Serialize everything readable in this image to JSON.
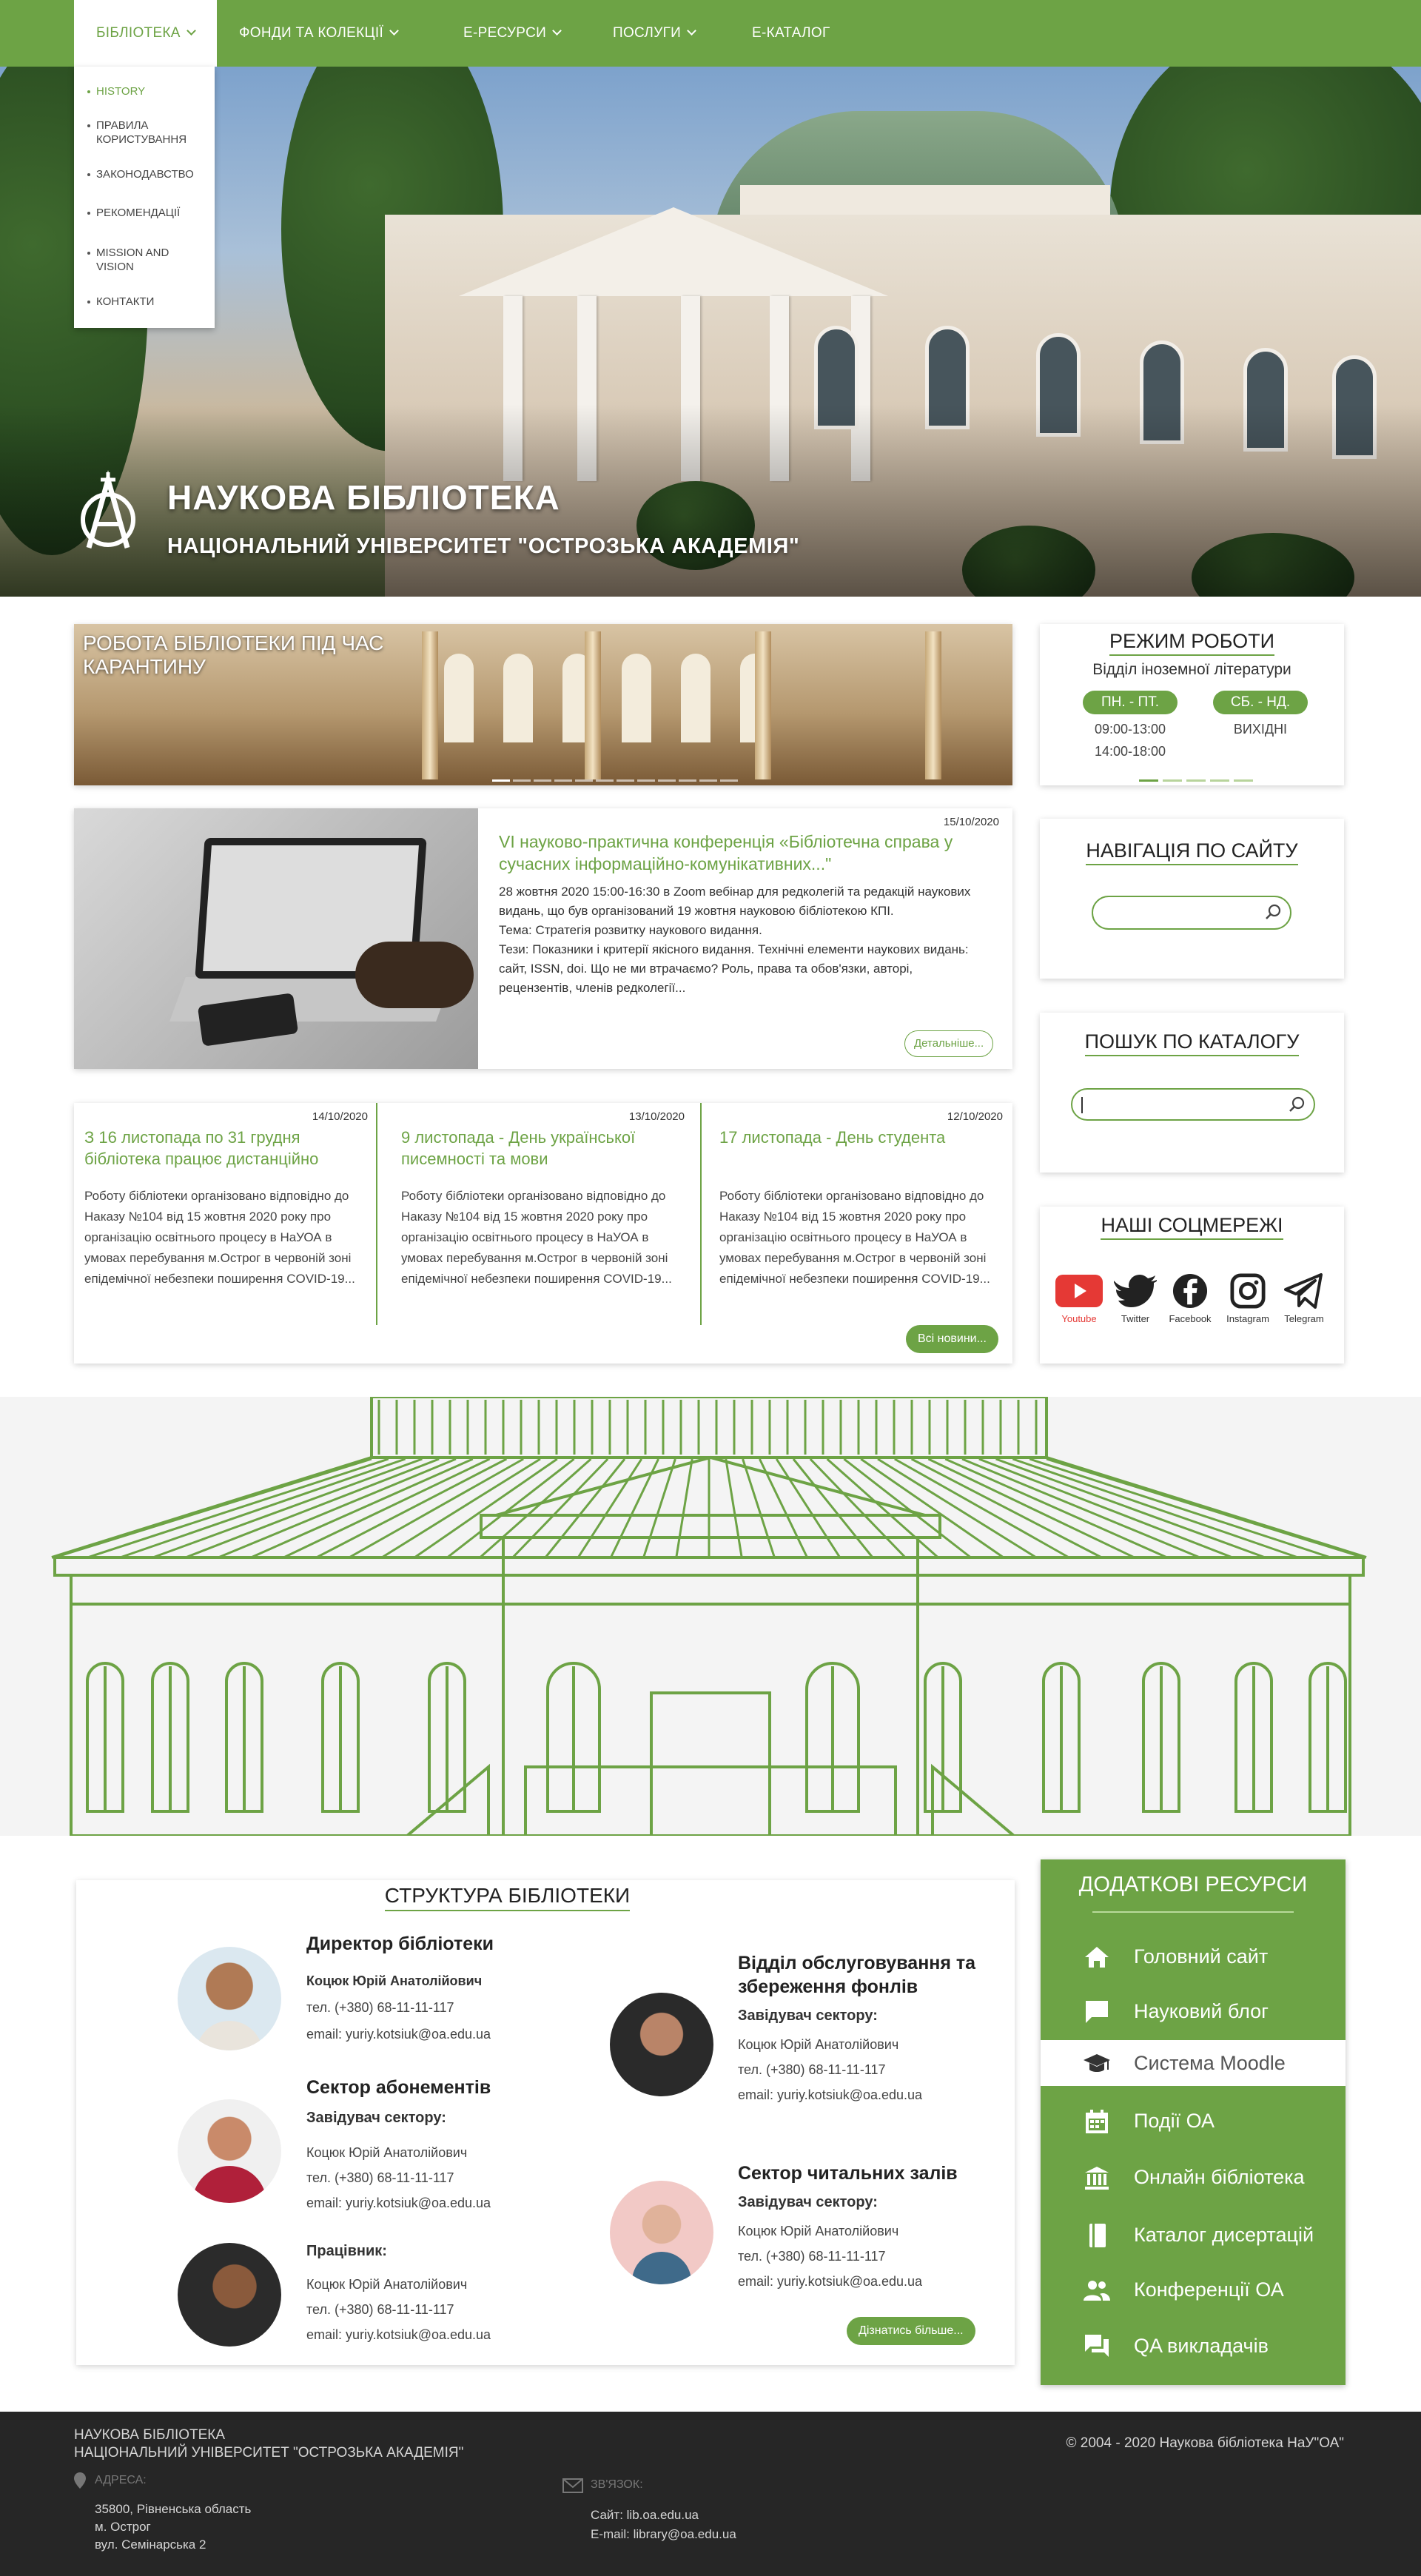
{
  "nav": {
    "items": [
      {
        "label": "БІБЛІОТЕКА"
      },
      {
        "label": "ФОНДИ ТА КОЛЕКЦІЇ"
      },
      {
        "label": "Е-РЕСУРСИ"
      },
      {
        "label": "ПОСЛУГИ"
      },
      {
        "label": "Е-КАТАЛОГ"
      }
    ],
    "dropdown": [
      "HISTORY",
      "ПРАВИЛА КОРИСТУВАННЯ",
      "ЗАКОНОДАВСТВО",
      "РЕКОМЕНДАЦІЇ",
      "MISSION AND VISION",
      "КОНТАКТИ"
    ]
  },
  "hero": {
    "title": "НАУКОВА БІБЛІОТЕКА",
    "subtitle": "НАЦІОНАЛЬНИЙ УНІВЕРСИТЕТ \"ОСТРОЗЬКА АКАДЕМІЯ\""
  },
  "slider": {
    "title": "РОБОТА БІБЛІОТЕКИ ПІД ЧАС КАРАНТИНУ",
    "dot_count": 12
  },
  "news_main": {
    "date": "15/10/2020",
    "title": "VI науково-практична конференція «Бібліотечна справа у сучасних інформаційно-комунікативних...\"",
    "text": "28 жовтня 2020 15:00-16:30 в Zoom вебінар для редколегій та редакцій наукових видань, що був організований 19 жовтня науковою бібліотекою КПІ.\nТема: Стратегія розвитку наукового видання.\nТези: Показники і критерії якісного видання. Технічні елементи наукових видань: сайт, ISSN, doi. Що не ми втрачаємо? Роль, права та обов'язки, авторі, рецензентів, членів редколегії...",
    "more": "Детальніше..."
  },
  "news": [
    {
      "date": "14/10/2020",
      "title": "З 16 листопада по 31 грудня бібліотека працює дистанційно",
      "text": "Роботу бібліотеки організовано відповідно до Наказу №104 від 15 жовтня 2020 року про організацію освітнього процесу в НаУОА в умовах перебування м.Острог в червоній зоні епідемічної небезпеки поширення COVID-19..."
    },
    {
      "date": "13/10/2020",
      "title": "9 листопада - День української писемності та мови",
      "text": "Роботу бібліотеки організовано відповідно до Наказу №104 від 15 жовтня 2020 року про організацію освітнього процесу в НаУОА в умовах перебування м.Острог в червоній зоні епідемічної небезпеки поширення COVID-19..."
    },
    {
      "date": "12/10/2020",
      "title": "17 листопада - День студента",
      "text": "Роботу бібліотеки організовано відповідно до Наказу №104 від 15 жовтня 2020 року про організацію освітнього процесу в НаУОА в умовах перебування м.Острог в червоній зоні епідемічної небезпеки поширення COVID-19..."
    }
  ],
  "all_news": "Всі новини...",
  "schedule": {
    "title": "РЕЖИМ РОБОТИ",
    "dept": "Відділ іноземної літератури",
    "weekdays": "ПН. - ПТ.",
    "weekend": "СБ. - НД.",
    "hours1": "09:00-13:00",
    "hours2": "14:00-18:00",
    "weekend_hours": "ВИХІДНІ"
  },
  "site_nav": {
    "title": "НАВІГАЦІЯ ПО САЙТУ",
    "placeholder": ""
  },
  "catalog": {
    "title": "ПОШУК ПО КАТАЛОГУ",
    "placeholder": ""
  },
  "social": {
    "title": "НАШІ СОЦМЕРЕЖІ",
    "items": [
      {
        "label": "Youtube",
        "icon": "youtube-icon"
      },
      {
        "label": "Twitter",
        "icon": "twitter-icon"
      },
      {
        "label": "Facebook",
        "icon": "facebook-icon"
      },
      {
        "label": "Instagram",
        "icon": "instagram-icon"
      },
      {
        "label": "Telegram",
        "icon": "telegram-icon"
      }
    ]
  },
  "structure": {
    "title": "СТРУКТУРА БІБЛІОТЕКИ",
    "people": [
      {
        "heading": "Директор бібліотеки",
        "role": "",
        "name": "Коцюк Юрій Анатолійович",
        "phone": "тел. (+380) 68-11-11-117",
        "email": "email: yuriy.kotsiuk@oa.edu.ua"
      },
      {
        "heading": "Сектор абонементів",
        "role": "Завідувач сектору:",
        "name": "Коцюк Юрій Анатолійович",
        "phone": "тел. (+380) 68-11-11-117",
        "email": "email: yuriy.kotsiuk@oa.edu.ua"
      },
      {
        "heading": "",
        "role": "Працівник:",
        "name": "Коцюк Юрій Анатолійович",
        "phone": "тел. (+380) 68-11-11-117",
        "email": "email: yuriy.kotsiuk@oa.edu.ua"
      },
      {
        "heading": "Відділ обслуговування та збереження фонлів",
        "role": "Завідувач сектору:",
        "name": "Коцюк Юрій Анатолійович",
        "phone": "тел. (+380) 68-11-11-117",
        "email": "email: yuriy.kotsiuk@oa.edu.ua"
      },
      {
        "heading": "Сектор читальних залів",
        "role": "Завідувач сектору:",
        "name": "Коцюк Юрій Анатолійович",
        "phone": "тел. (+380) 68-11-11-117",
        "email": "email: yuriy.kotsiuk@oa.edu.ua"
      }
    ],
    "more": "Дізнатись більше..."
  },
  "resources": {
    "title": "ДОДАТКОВІ РЕСУРСИ",
    "items": [
      {
        "label": "Головний сайт",
        "icon": "home-icon"
      },
      {
        "label": "Науковий блог",
        "icon": "chat-bubble-icon"
      },
      {
        "label": "Система Moodle",
        "icon": "graduation-cap-icon"
      },
      {
        "label": "Події ОА",
        "icon": "calendar-icon"
      },
      {
        "label": "Онлайн бібліотека",
        "icon": "library-building-icon"
      },
      {
        "label": "Каталог дисертацій",
        "icon": "book-icon"
      },
      {
        "label": "Конференції ОА",
        "icon": "group-icon"
      },
      {
        "label": "QA викладачів",
        "icon": "forum-icon"
      }
    ]
  },
  "footer": {
    "line1": "НАУКОВА БІБЛІОТЕКА",
    "line2": "НАЦІОНАЛЬНИЙ УНІВЕРСИТЕТ \"ОСТРОЗЬКА АКАДЕМІЯ\"",
    "copyright": "© 2004 - 2020 Наукова бібліотека НаУ\"ОА\"",
    "address_label": "АДРЕСА:",
    "address1": "35800, Рівненська область",
    "address2": "м. Острог",
    "address3": "вул. Семінарська 2",
    "contact_label": "ЗВ'ЯЗОК:",
    "site": "Сайт: lib.oa.edu.ua",
    "email": "E-mail: library@oa.edu.ua"
  },
  "colors": {
    "accent": "#6da345",
    "footer": "#262626",
    "youtube": "#e53935"
  }
}
